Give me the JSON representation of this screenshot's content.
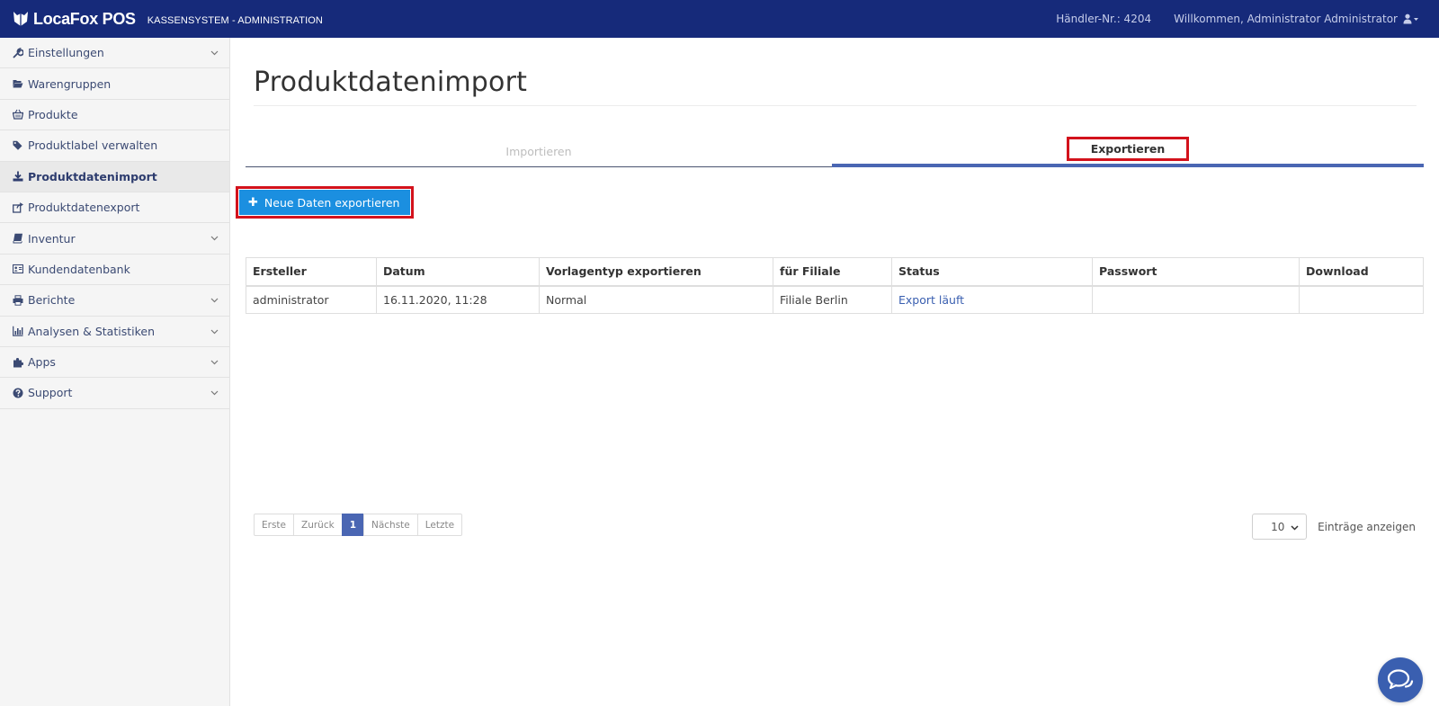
{
  "header": {
    "brand_name": "LocaFox POS",
    "brand_sub": "KASSENSYSTEM - ADMINISTRATION",
    "merchant": "Händler-Nr.: 4204",
    "welcome": "Willkommen, Administrator Administrator"
  },
  "sidebar": {
    "items": [
      {
        "label": "Einstellungen",
        "icon": "wrench-icon"
      },
      {
        "label": "Warengruppen",
        "icon": "folder-open-icon"
      },
      {
        "label": "Produkte",
        "icon": "basket-icon"
      },
      {
        "label": "Produktlabel verwalten",
        "icon": "tags-icon"
      },
      {
        "label": "Produktdatenimport",
        "icon": "download-icon"
      },
      {
        "label": "Produktdatenexport",
        "icon": "share-icon"
      },
      {
        "label": "Inventur",
        "icon": "book-icon"
      },
      {
        "label": "Kundendatenbank",
        "icon": "id-card-icon"
      },
      {
        "label": "Berichte",
        "icon": "printer-icon"
      },
      {
        "label": "Analysen & Statistiken",
        "icon": "bar-chart-icon"
      },
      {
        "label": "Apps",
        "icon": "puzzle-icon"
      },
      {
        "label": "Support",
        "icon": "question-circle-icon"
      }
    ]
  },
  "main": {
    "title": "Produktdatenimport",
    "tabs": [
      {
        "label": "Importieren"
      },
      {
        "label": "Exportieren"
      }
    ],
    "new_button": "Neue Daten exportieren",
    "table": {
      "headers": [
        "Ersteller",
        "Datum",
        "Vorlagentyp exportieren",
        "für Filiale",
        "Status",
        "Passwort",
        "Download"
      ],
      "rows": [
        [
          "administrator",
          "16.11.2020, 11:28",
          "Normal",
          "Filiale Berlin",
          "Export läuft",
          "",
          ""
        ]
      ]
    },
    "pager": {
      "first": "Erste",
      "prev": "Zurück",
      "current": "1",
      "next": "Nächste",
      "last": "Letzte"
    },
    "page_size": {
      "value": "10",
      "label": "Einträge anzeigen"
    }
  },
  "colors": {
    "topbar": "#162a7a",
    "accent": "#4a66b3",
    "button": "#1b8fe0",
    "highlight": "#d3121c"
  }
}
